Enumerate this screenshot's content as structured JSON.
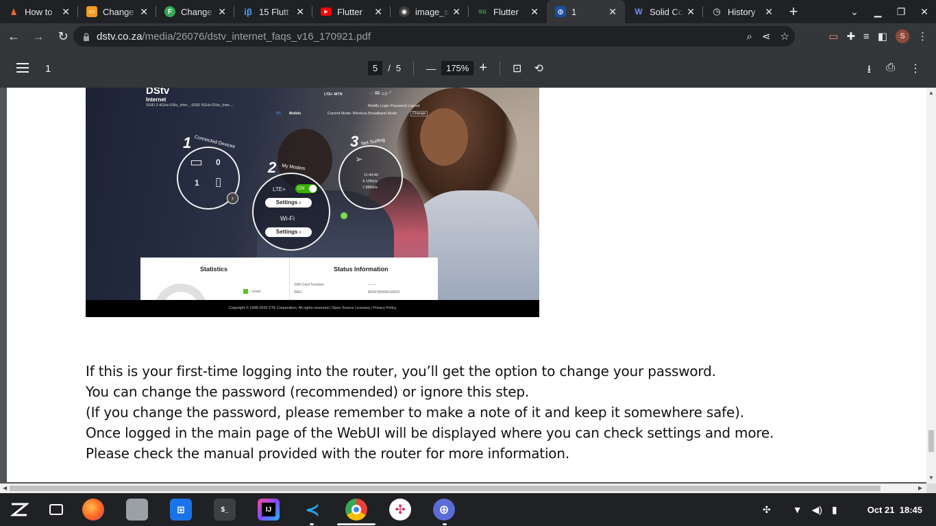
{
  "browser": {
    "tabs": [
      {
        "title": "How to",
        "favicon": "dark-flame-icon",
        "color": "#202124"
      },
      {
        "title": "Change",
        "favicon": "orange-blog-icon",
        "color": "#f29b1f"
      },
      {
        "title": "Change",
        "favicon": "green-f-icon",
        "color": "#34a853"
      },
      {
        "title": "15 Flutt",
        "favicon": "ib-icon",
        "color": "#4aa3ff"
      },
      {
        "title": "Flutter",
        "favicon": "youtube-icon",
        "color": "#ff0000"
      },
      {
        "title": "image_s",
        "favicon": "github-icon",
        "color": "#555555"
      },
      {
        "title": "Flutter",
        "favicon": "geeks-icon",
        "color": "#2f8d46"
      },
      {
        "title": "1",
        "favicon": "pdf-icon",
        "color": "#1a4ea1",
        "active": true
      },
      {
        "title": "Solid Cc",
        "favicon": "w-icon",
        "color": "#3b5bdb"
      },
      {
        "title": "History",
        "favicon": "history-icon",
        "color": "#e8eaed"
      }
    ],
    "url_domain": "dstv.co.za",
    "url_path": "/media/26076/dstv_internet_faqs_v16_170921.pdf",
    "profile_initial": "S"
  },
  "pdf_toolbar": {
    "title": "1",
    "current_page": "5",
    "page_sep": "/",
    "total_pages": "5",
    "zoom": "175%",
    "zoom_out": "—",
    "zoom_in": "+"
  },
  "router_ui": {
    "brand": "DStv",
    "brand_sub": "Internet",
    "ssid": "SSID 2.4GHz:DStv_Inter...;SSID 5GHz:DStv_Inter...;",
    "network": "LTE+   MTN",
    "login_links": "Modify Login Password   Logout",
    "mode": "Current Mode: Wireless Broadband Mode",
    "mode_change": "Change",
    "pc_label": "PC",
    "mobile_label": "Mobile",
    "section1": "Connected Devices",
    "section1_num": "1",
    "pc_count": "0",
    "mobile_count": "1",
    "section2": "My Modem",
    "section2_num": "2",
    "lte_label": "LTE+",
    "lte_toggle": "ON",
    "settings_label": "Settings",
    "wifi_label": "Wi-Fi",
    "section3": "Net Surfing",
    "section3_num": "3",
    "time": "11:44:40",
    "down_rate": "4.13Kb/s",
    "up_rate": "7.88Kb/s",
    "statistics": "Statistics",
    "status_info": "Status Information",
    "used_label": "Used",
    "sim_label": "SIM Card Number",
    "sim_value": "— —",
    "imei_label": "IMEI",
    "imei_value": "860978040519429",
    "footer": "Copyright © 1998-2020 ZTE Corporation. All rights reserved  |  Open Source Licenses  |  Privacy Policy"
  },
  "paragraph": [
    "If this is your first-time logging into the router, you’ll get the option to change your password.",
    "You can change the password (recommended) or ignore this step.",
    "(If you change the password, please remember to make a note of it and keep it somewhere safe).",
    "Once logged in the main page of the WebUI will be displayed where you can check settings and more.",
    "Please check the manual provided with the router for more information."
  ],
  "shelf": {
    "apps": [
      "files-icon",
      "firefox-icon",
      "folder-icon",
      "store-icon",
      "terminal-icon",
      "intellij-icon",
      "vscode-icon",
      "chrome-icon",
      "slack-icon",
      "globe-icon"
    ],
    "date": "Oct 21",
    "time": "18:45"
  }
}
